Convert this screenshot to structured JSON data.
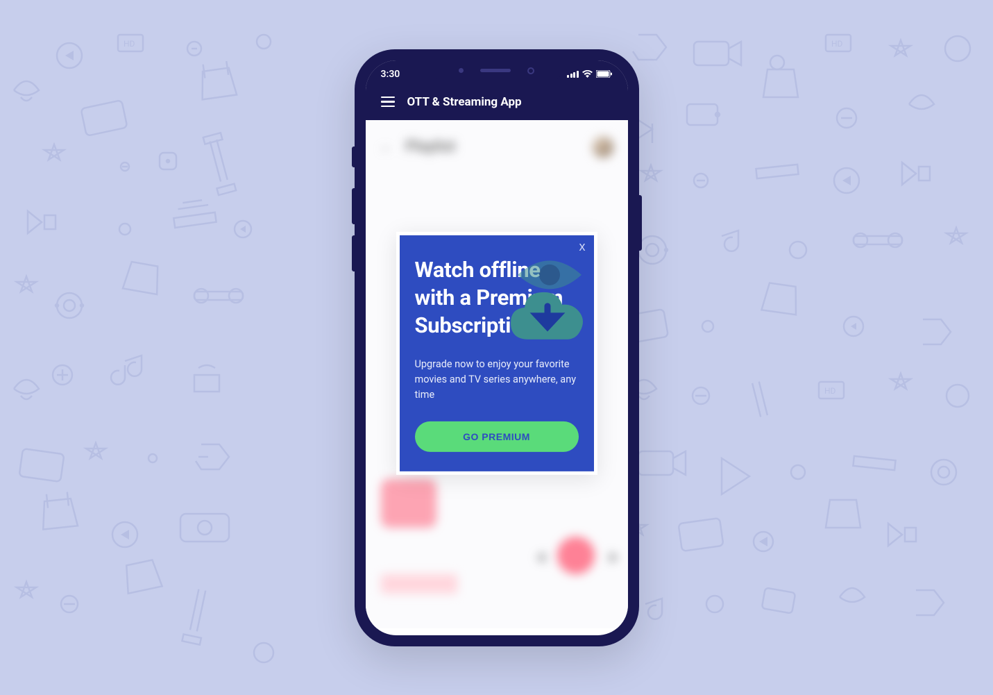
{
  "status_bar": {
    "time": "3:30"
  },
  "header": {
    "app_title": "OTT & Streaming App"
  },
  "background_screen": {
    "title": "Playlist"
  },
  "modal": {
    "close_label": "x",
    "heading": "Watch offline with a Premium Subscription",
    "body": "Upgrade now to enjoy your favorite movies and TV series anywhere, any time",
    "cta_label": "GO PREMIUM"
  }
}
